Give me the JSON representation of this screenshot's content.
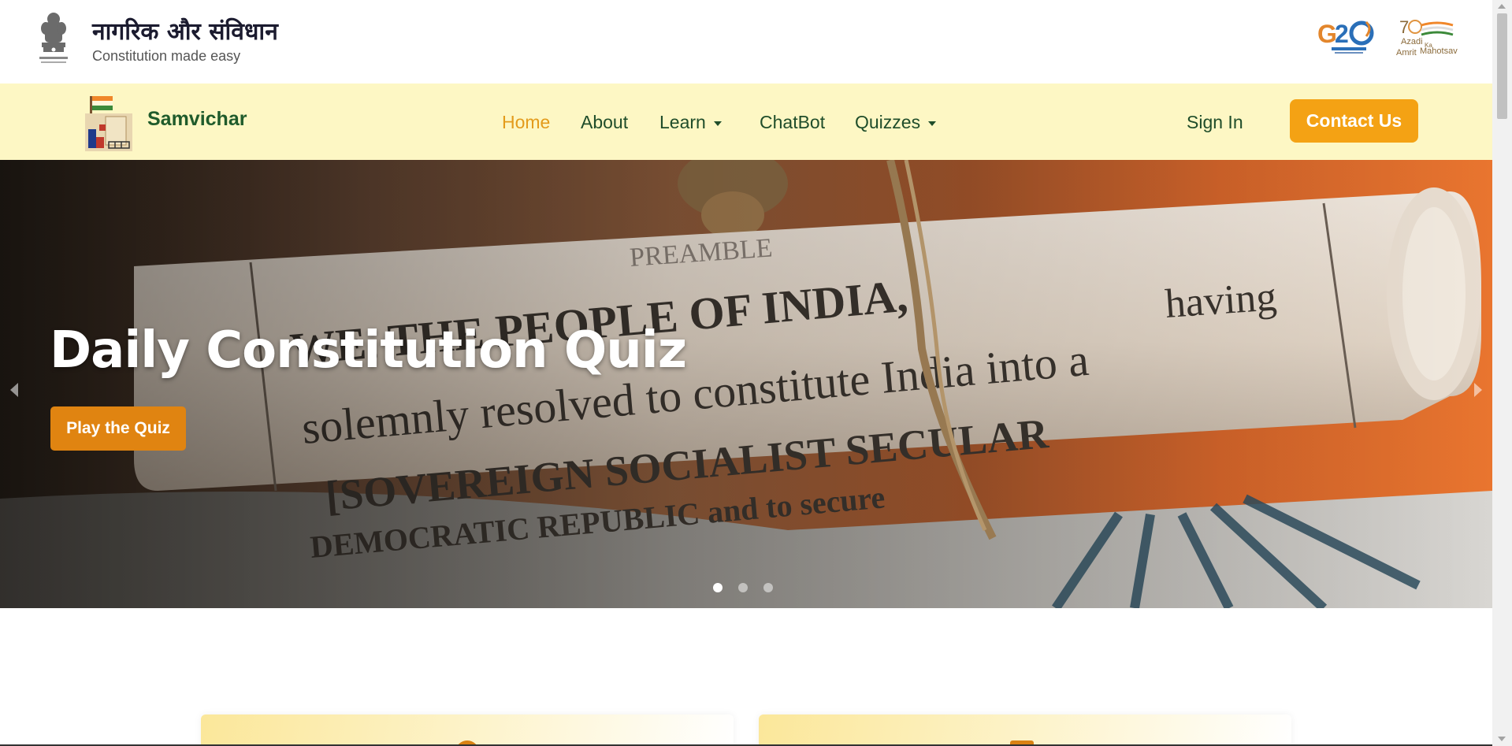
{
  "header": {
    "title": "नागरिक और संविधान",
    "subtitle": "Constitution made easy"
  },
  "navbar": {
    "brand": "Samvichar",
    "links": [
      {
        "label": "Home",
        "active": true
      },
      {
        "label": "About",
        "active": false
      },
      {
        "label": "Learn",
        "active": false,
        "dropdown": true
      },
      {
        "label": "ChatBot",
        "active": false
      },
      {
        "label": "Quizzes",
        "active": false,
        "dropdown": true
      }
    ],
    "sign_in": "Sign In",
    "contact": "Contact Us"
  },
  "hero": {
    "title": "Daily Constitution Quiz",
    "button": "Play the Quiz",
    "slides": 3,
    "active_slide": 1
  },
  "colors": {
    "accent": "#f4a214",
    "nav_bg": "#fdf7c4",
    "brand_green": "#1f5b2b",
    "active_link": "#e39b1b",
    "hero_button": "#e08411"
  },
  "icons": [
    "national-emblem-icon",
    "g20-logo",
    "azadi-ka-amrit-mahotsav-logo",
    "samvichar-logo",
    "chevron-left-icon",
    "chevron-right-icon"
  ]
}
